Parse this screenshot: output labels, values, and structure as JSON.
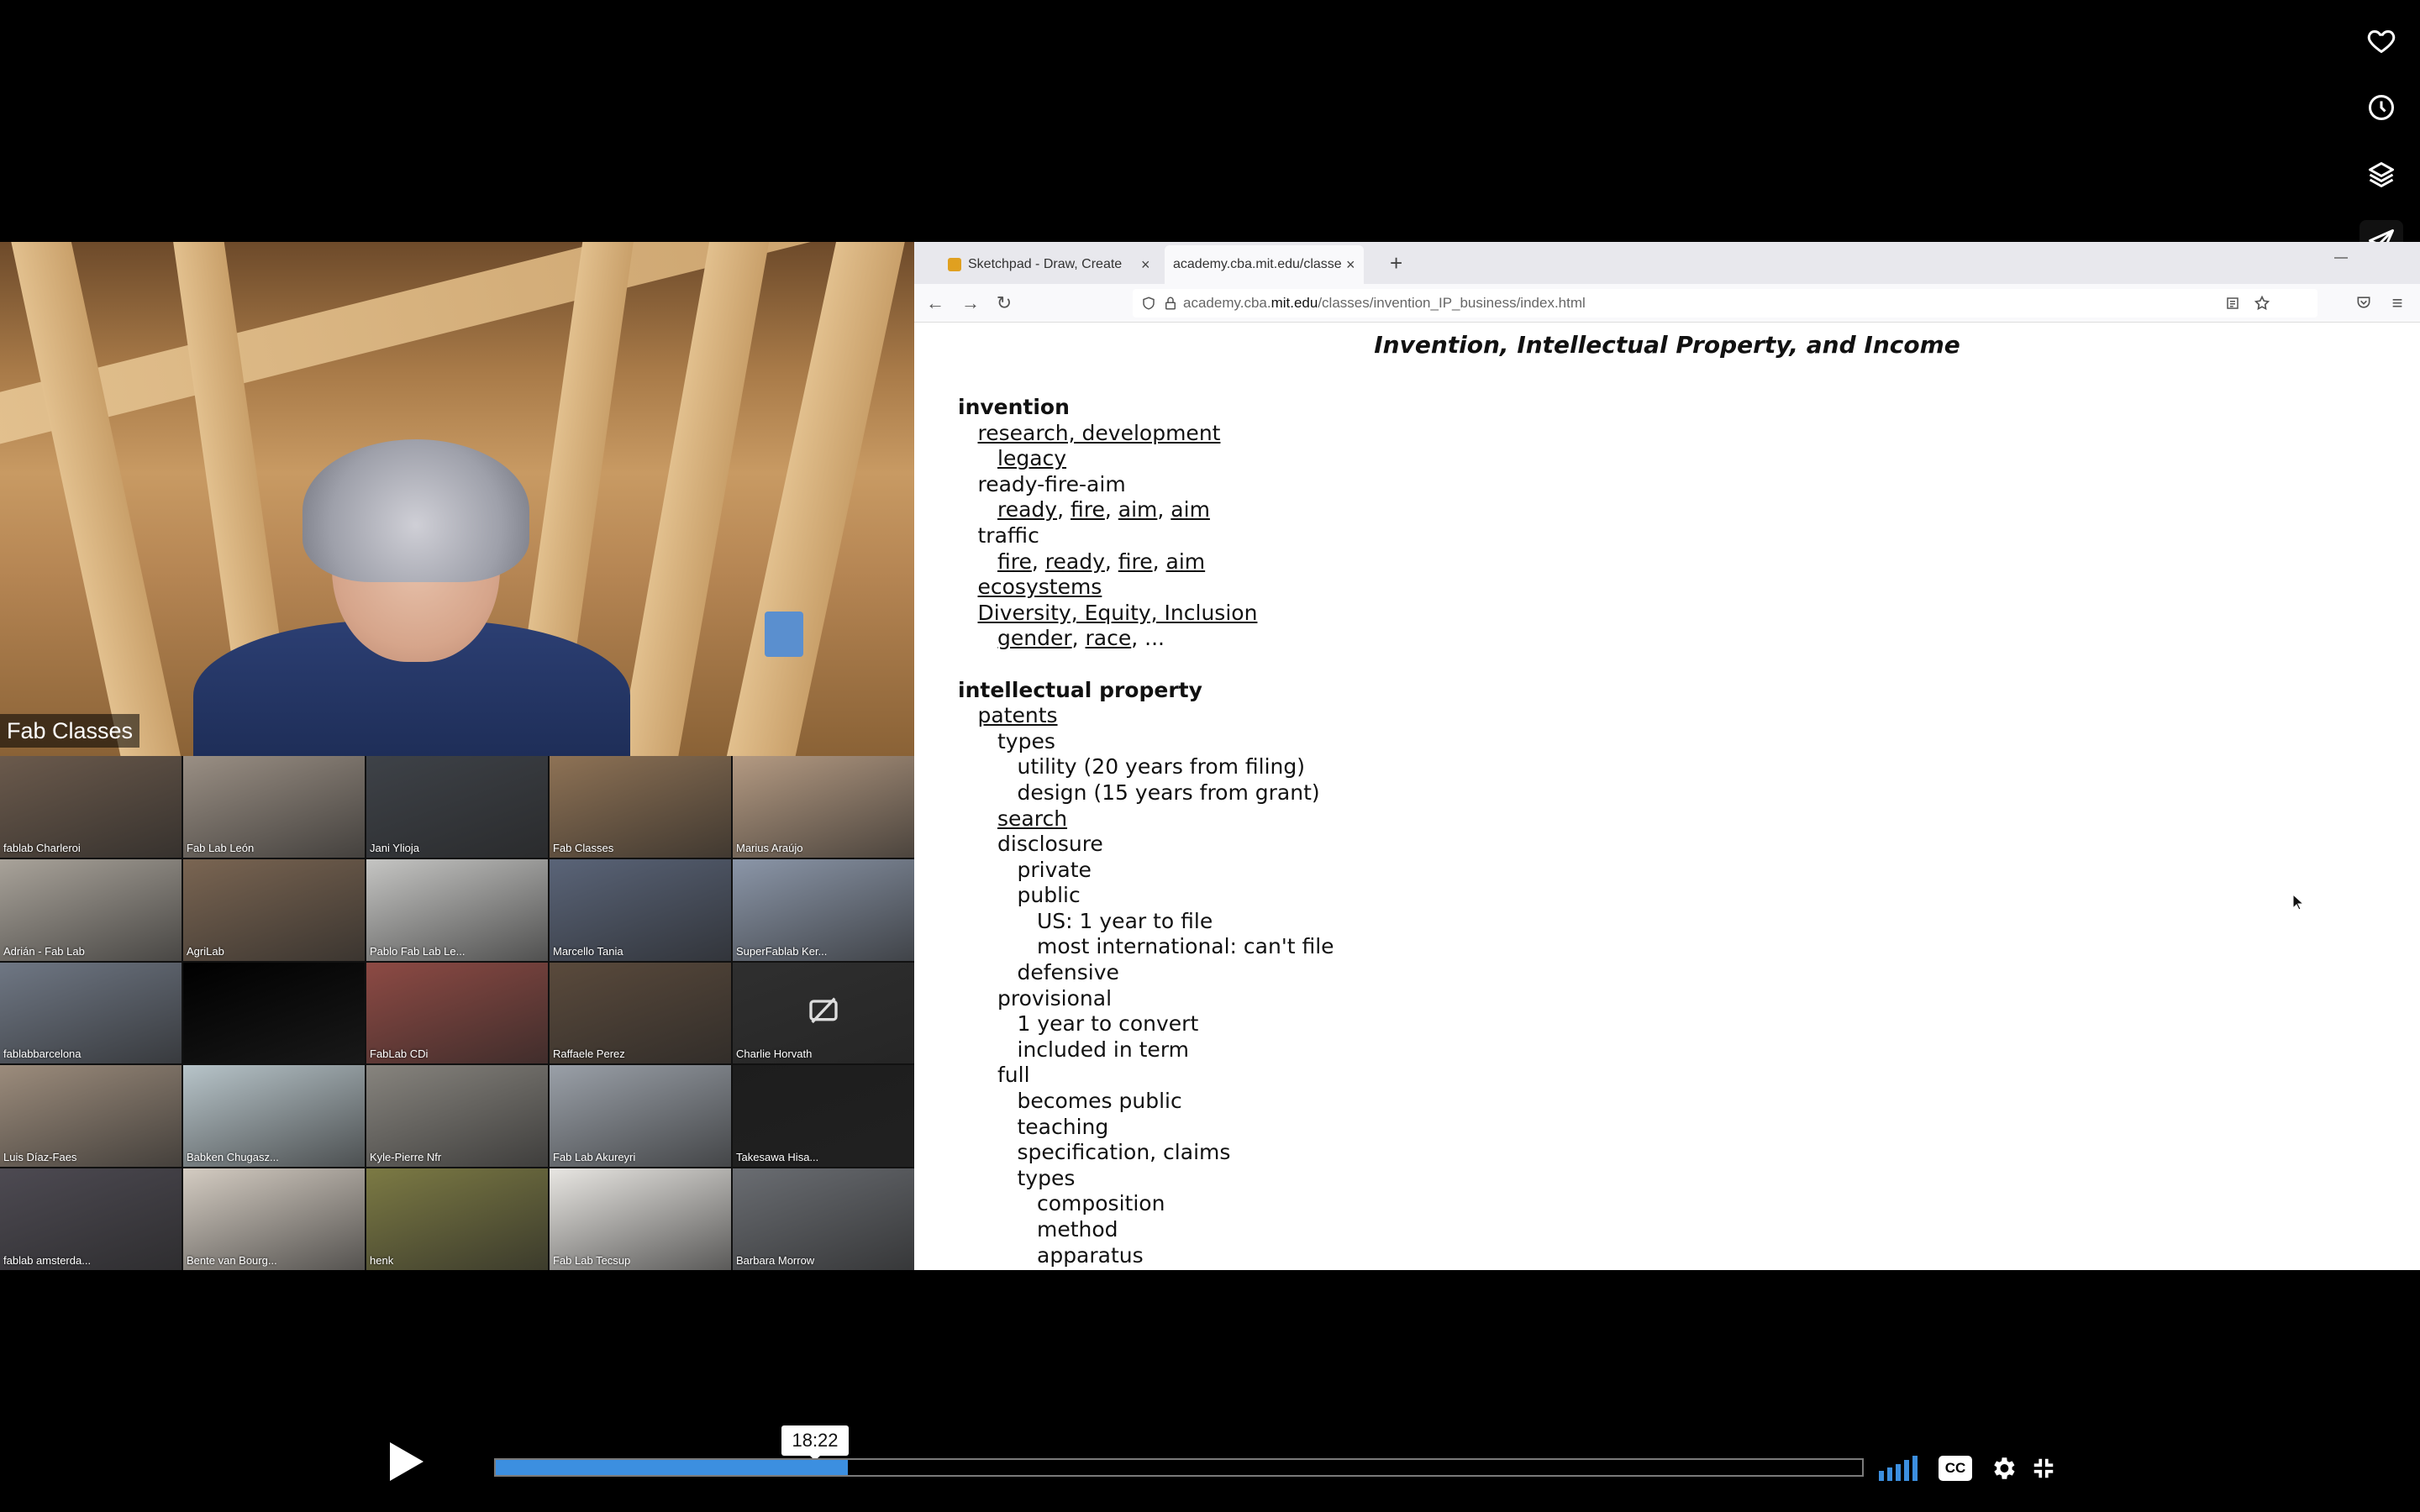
{
  "player": {
    "time_tooltip": "18:22",
    "progress": 0.2575,
    "cc_label": "CC"
  },
  "side_icons": [
    "heart-icon",
    "clock-icon",
    "layers-icon",
    "send-icon"
  ],
  "zoom": {
    "speaker_name": "Fab Classes",
    "tiles": [
      {
        "label": "fablab Charleroi",
        "color": "#6b5a4c"
      },
      {
        "label": "Fab Lab León",
        "color": "#9a8f84"
      },
      {
        "label": "Jani Ylioja",
        "color": "#3e4248"
      },
      {
        "label": "Fab Classes",
        "color": "#8e7255"
      },
      {
        "label": "Marius Araújo",
        "color": "#b49a82"
      },
      {
        "label": "Adrián - Fab Lab",
        "color": "#a9a39a"
      },
      {
        "label": "AgriLab",
        "color": "#7a6552"
      },
      {
        "label": "Pablo Fab Lab Le...",
        "color": "#c5c5c3"
      },
      {
        "label": "Marcello Tania",
        "color": "#5a6478"
      },
      {
        "label": "SuperFablab Ker...",
        "color": "#8b96a8"
      },
      {
        "label": "fablabbarcelona",
        "color": "#6f7784"
      },
      {
        "label": "",
        "color": "#000000"
      },
      {
        "label": "FabLab CDi",
        "color": "#8d4a44"
      },
      {
        "label": "Raffaele Perez",
        "color": "#5a4a3c"
      },
      {
        "label": "Charlie Horvath",
        "color": "#2f2f2f"
      },
      {
        "label": "Luis Díaz-Faes",
        "color": "#9c8c7c"
      },
      {
        "label": "Babken Chugasz...",
        "color": "#b7c4c9"
      },
      {
        "label": "Kyle-Pierre Nfr",
        "color": "#87847e"
      },
      {
        "label": "Fab Lab Akureyri",
        "color": "#9aa0a8"
      },
      {
        "label": "Takesawa Hisa...",
        "color": "#1d1d1d"
      },
      {
        "label": "fablab amsterda...",
        "color": "#4d4a52"
      },
      {
        "label": "Bente van Bourg...",
        "color": "#d4ccc2"
      },
      {
        "label": "henk",
        "color": "#7c7a44"
      },
      {
        "label": "Fab Lab Tecsup",
        "color": "#e8e6e2"
      },
      {
        "label": "Barbara Morrow",
        "color": "#6a6d72"
      }
    ]
  },
  "browser": {
    "tabs": [
      {
        "label": "Sketchpad - Draw, Create",
        "favicon_color": "#e0a020"
      },
      {
        "label": "academy.cba.mit.edu/classe",
        "favicon_color": ""
      }
    ],
    "url_domain_prefix": "academy.cba.",
    "url_domain_main": "mit.edu",
    "url_path": "/classes/invention_IP_business/index.html",
    "page_title": "Invention, Intellectual Property, and Income",
    "outline": [
      {
        "type": "heading",
        "indent": 0,
        "parts": [
          {
            "t": "invention",
            "link": false
          }
        ]
      },
      {
        "type": "item",
        "indent": 1,
        "parts": [
          {
            "t": "research, development",
            "link": true
          }
        ]
      },
      {
        "type": "item",
        "indent": 2,
        "parts": [
          {
            "t": "legacy",
            "link": true
          }
        ]
      },
      {
        "type": "item",
        "indent": 1,
        "parts": [
          {
            "t": "ready-fire-aim",
            "link": false
          }
        ]
      },
      {
        "type": "item",
        "indent": 2,
        "parts": [
          {
            "t": "ready",
            "link": true
          },
          {
            "t": ", ",
            "link": false
          },
          {
            "t": "fire",
            "link": true
          },
          {
            "t": ", ",
            "link": false
          },
          {
            "t": "aim",
            "link": true
          },
          {
            "t": ", ",
            "link": false
          },
          {
            "t": "aim",
            "link": true
          }
        ]
      },
      {
        "type": "item",
        "indent": 1,
        "parts": [
          {
            "t": "traffic",
            "link": false
          }
        ]
      },
      {
        "type": "item",
        "indent": 2,
        "parts": [
          {
            "t": "fire",
            "link": true
          },
          {
            "t": ", ",
            "link": false
          },
          {
            "t": "ready",
            "link": true
          },
          {
            "t": ", ",
            "link": false
          },
          {
            "t": "fire",
            "link": true
          },
          {
            "t": ", ",
            "link": false
          },
          {
            "t": "aim",
            "link": true
          }
        ]
      },
      {
        "type": "item",
        "indent": 1,
        "parts": [
          {
            "t": "ecosystems",
            "link": true
          }
        ]
      },
      {
        "type": "item",
        "indent": 1,
        "parts": [
          {
            "t": "Diversity, Equity, Inclusion",
            "link": true
          }
        ]
      },
      {
        "type": "item",
        "indent": 2,
        "parts": [
          {
            "t": "gender",
            "link": true
          },
          {
            "t": ", ",
            "link": false
          },
          {
            "t": "race",
            "link": true
          },
          {
            "t": ", ...",
            "link": false
          }
        ]
      },
      {
        "type": "gap",
        "indent": 0,
        "parts": []
      },
      {
        "type": "heading",
        "indent": 0,
        "parts": [
          {
            "t": "intellectual property",
            "link": false
          }
        ]
      },
      {
        "type": "item",
        "indent": 1,
        "parts": [
          {
            "t": "patents",
            "link": true
          }
        ]
      },
      {
        "type": "item",
        "indent": 2,
        "parts": [
          {
            "t": "types",
            "link": false
          }
        ]
      },
      {
        "type": "item",
        "indent": 3,
        "parts": [
          {
            "t": "utility (20 years from filing)",
            "link": false
          }
        ]
      },
      {
        "type": "item",
        "indent": 3,
        "parts": [
          {
            "t": "design (15 years from grant)",
            "link": false
          }
        ]
      },
      {
        "type": "item",
        "indent": 2,
        "parts": [
          {
            "t": "search",
            "link": true
          }
        ]
      },
      {
        "type": "item",
        "indent": 2,
        "parts": [
          {
            "t": "disclosure",
            "link": false
          }
        ]
      },
      {
        "type": "item",
        "indent": 3,
        "parts": [
          {
            "t": "private",
            "link": false
          }
        ]
      },
      {
        "type": "item",
        "indent": 3,
        "parts": [
          {
            "t": "public",
            "link": false
          }
        ]
      },
      {
        "type": "item",
        "indent": 4,
        "parts": [
          {
            "t": "US: 1 year to file",
            "link": false
          }
        ]
      },
      {
        "type": "item",
        "indent": 4,
        "parts": [
          {
            "t": "most international: can't file",
            "link": false
          }
        ]
      },
      {
        "type": "item",
        "indent": 3,
        "parts": [
          {
            "t": "defensive",
            "link": false
          }
        ]
      },
      {
        "type": "item",
        "indent": 2,
        "parts": [
          {
            "t": "provisional",
            "link": false
          }
        ]
      },
      {
        "type": "item",
        "indent": 3,
        "parts": [
          {
            "t": "1 year to convert",
            "link": false
          }
        ]
      },
      {
        "type": "item",
        "indent": 3,
        "parts": [
          {
            "t": "included in term",
            "link": false
          }
        ]
      },
      {
        "type": "item",
        "indent": 2,
        "parts": [
          {
            "t": "full",
            "link": false
          }
        ]
      },
      {
        "type": "item",
        "indent": 3,
        "parts": [
          {
            "t": "becomes public",
            "link": false
          }
        ]
      },
      {
        "type": "item",
        "indent": 3,
        "parts": [
          {
            "t": "teaching",
            "link": false
          }
        ]
      },
      {
        "type": "item",
        "indent": 3,
        "parts": [
          {
            "t": "specification, claims",
            "link": false
          }
        ]
      },
      {
        "type": "item",
        "indent": 3,
        "parts": [
          {
            "t": "types",
            "link": false
          }
        ]
      },
      {
        "type": "item",
        "indent": 4,
        "parts": [
          {
            "t": "composition",
            "link": false
          }
        ]
      },
      {
        "type": "item",
        "indent": 4,
        "parts": [
          {
            "t": "method",
            "link": false
          }
        ]
      },
      {
        "type": "item",
        "indent": 4,
        "parts": [
          {
            "t": "apparatus",
            "link": false
          }
        ]
      }
    ]
  }
}
